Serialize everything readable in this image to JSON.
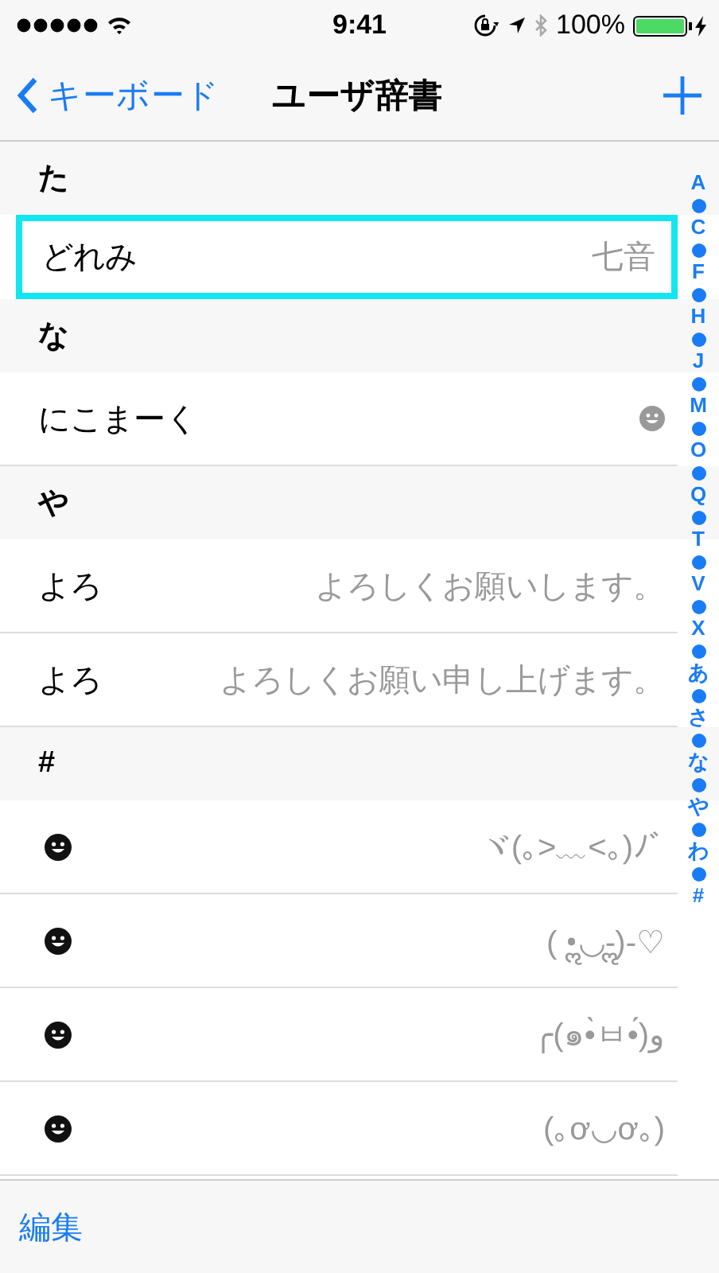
{
  "status_bar": {
    "time": "9:41",
    "battery_text": "100%"
  },
  "nav": {
    "back": "キーボード",
    "title": "ユーザ辞書"
  },
  "sections": [
    {
      "header": "た",
      "entries": [
        {
          "phrase": "どれみ",
          "reading": "七音",
          "selected": true
        }
      ]
    },
    {
      "header": "な",
      "entries": [
        {
          "phrase": "にこまーく",
          "selected": false
        }
      ]
    },
    {
      "header": "や",
      "entries": [
        {
          "phrase": "よろ",
          "reading": "よろしくお願いします。",
          "selected": false
        },
        {
          "phrase": "よろ",
          "reading": "よろしくお願い申し上げます。",
          "selected": false
        }
      ]
    },
    {
      "header": "#",
      "entries": [
        {
          "reading": "ヾ(｡>﹏<｡)ﾉﾞ",
          "selected": false
        },
        {
          "reading": "( •ॢ◡-ॢ)-♡",
          "selected": false
        },
        {
          "reading": "╭(๑•̀ㅂ•́)و",
          "selected": false
        },
        {
          "reading": "(｡ơ◡ơ｡)",
          "selected": false
        }
      ]
    }
  ],
  "index": [
    "A",
    "C",
    "F",
    "H",
    "J",
    "M",
    "O",
    "Q",
    "T",
    "V",
    "X",
    "あ",
    "さ",
    "な",
    "や",
    "わ",
    "#"
  ],
  "toolbar": {
    "edit": "編集"
  }
}
